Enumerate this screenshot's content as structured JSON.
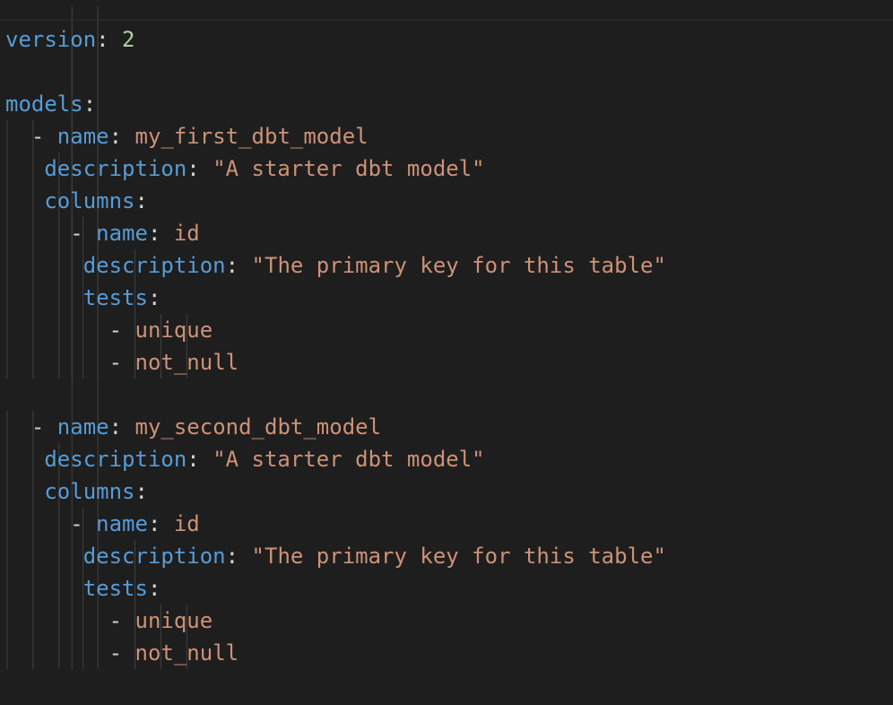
{
  "document": {
    "lines": [
      {
        "indent": 0,
        "dash": false,
        "key": "version",
        "value": "2",
        "value_type": "num"
      },
      {
        "blank": true
      },
      {
        "indent": 0,
        "dash": false,
        "key": "models",
        "value": "",
        "value_type": "none"
      },
      {
        "indent": 2,
        "dash": true,
        "key": "name",
        "value": "my_first_dbt_model",
        "value_type": "str"
      },
      {
        "indent": 3,
        "dash": false,
        "key": "description",
        "value": "\"A starter dbt model\"",
        "value_type": "str"
      },
      {
        "indent": 3,
        "dash": false,
        "key": "columns",
        "value": "",
        "value_type": "none"
      },
      {
        "indent": 5,
        "dash": true,
        "key": "name",
        "value": "id",
        "value_type": "str"
      },
      {
        "indent": 6,
        "dash": false,
        "key": "description",
        "value": "\"The primary key for this table\"",
        "value_type": "str"
      },
      {
        "indent": 6,
        "dash": false,
        "key": "tests",
        "value": "",
        "value_type": "none"
      },
      {
        "indent": 8,
        "dash": true,
        "key": "",
        "value": "unique",
        "value_type": "str"
      },
      {
        "indent": 8,
        "dash": true,
        "key": "",
        "value": "not_null",
        "value_type": "str"
      },
      {
        "blank": true
      },
      {
        "indent": 2,
        "dash": true,
        "key": "name",
        "value": "my_second_dbt_model",
        "value_type": "str"
      },
      {
        "indent": 3,
        "dash": false,
        "key": "description",
        "value": "\"A starter dbt model\"",
        "value_type": "str"
      },
      {
        "indent": 3,
        "dash": false,
        "key": "columns",
        "value": "",
        "value_type": "none"
      },
      {
        "indent": 5,
        "dash": true,
        "key": "name",
        "value": "id",
        "value_type": "str"
      },
      {
        "indent": 6,
        "dash": false,
        "key": "description",
        "value": "\"The primary key for this table\"",
        "value_type": "str"
      },
      {
        "indent": 6,
        "dash": false,
        "key": "tests",
        "value": "",
        "value_type": "none"
      },
      {
        "indent": 8,
        "dash": true,
        "key": "",
        "value": "unique",
        "value_type": "str"
      },
      {
        "indent": 8,
        "dash": true,
        "key": "",
        "value": "not_null",
        "value_type": "str"
      }
    ]
  },
  "colors": {
    "background": "#1e1e1e",
    "key": "#569cd6",
    "string": "#ce9178",
    "number": "#b5cea8",
    "punctuation": "#d4d4d4",
    "indent_guide": "#404040"
  }
}
